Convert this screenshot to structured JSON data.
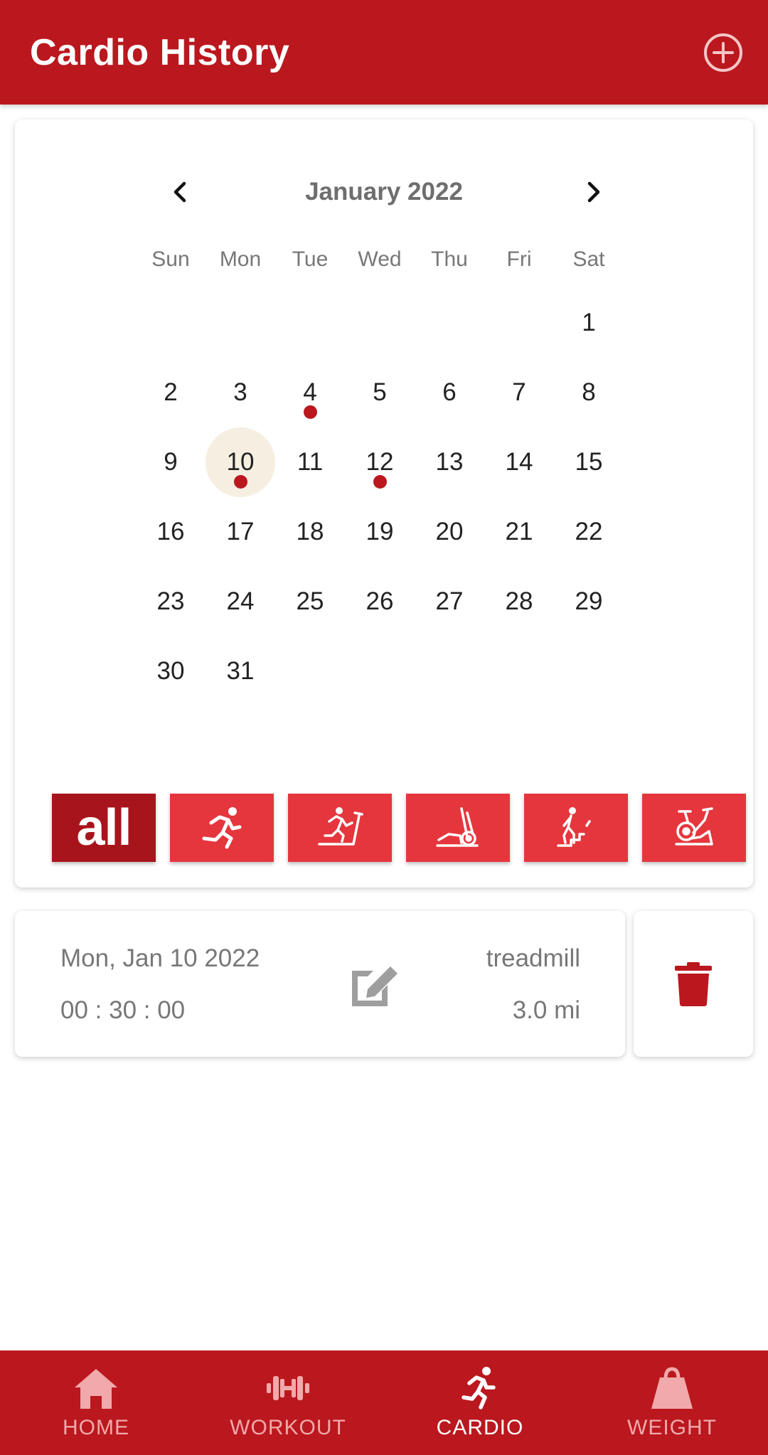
{
  "app_bar": {
    "title": "Cardio History",
    "add_icon": "add-circle-icon"
  },
  "calendar": {
    "month_label": "January 2022",
    "prev_icon": "chevron-left-icon",
    "next_icon": "chevron-right-icon",
    "weekdays": [
      "Sun",
      "Mon",
      "Tue",
      "Wed",
      "Thu",
      "Fri",
      "Sat"
    ],
    "days": [
      "",
      "",
      "",
      "",
      "",
      "",
      "1",
      "2",
      "3",
      "4",
      "5",
      "6",
      "7",
      "8",
      "9",
      "10",
      "11",
      "12",
      "13",
      "14",
      "15",
      "16",
      "17",
      "18",
      "19",
      "20",
      "21",
      "22",
      "23",
      "24",
      "25",
      "26",
      "27",
      "28",
      "29",
      "30",
      "31"
    ],
    "selected_day": "10",
    "days_with_entries": [
      "4",
      "10",
      "12"
    ]
  },
  "filters": {
    "all_label": "all",
    "items": [
      {
        "name": "running-icon"
      },
      {
        "name": "treadmill-icon"
      },
      {
        "name": "elliptical-icon"
      },
      {
        "name": "stair-climber-icon"
      },
      {
        "name": "stationary-bike-icon"
      }
    ]
  },
  "entry": {
    "date": "Mon, Jan 10 2022",
    "duration": "00 : 30 : 00",
    "type": "treadmill",
    "distance": "3.0 mi",
    "edit_icon": "edit-icon",
    "delete_icon": "trash-icon"
  },
  "bottom_nav": {
    "items": [
      {
        "label": "HOME",
        "icon": "home-icon"
      },
      {
        "label": "WORKOUT",
        "icon": "dumbbell-icon"
      },
      {
        "label": "CARDIO",
        "icon": "running-icon"
      },
      {
        "label": "WEIGHT",
        "icon": "weight-icon"
      }
    ],
    "active": "CARDIO"
  },
  "colors": {
    "primary": "#BA181E",
    "filter_button": "#E5363D",
    "filter_active": "#A8141B",
    "selected_day_bg": "#F6EEE1",
    "nav_inactive": "#F1A9AB"
  }
}
